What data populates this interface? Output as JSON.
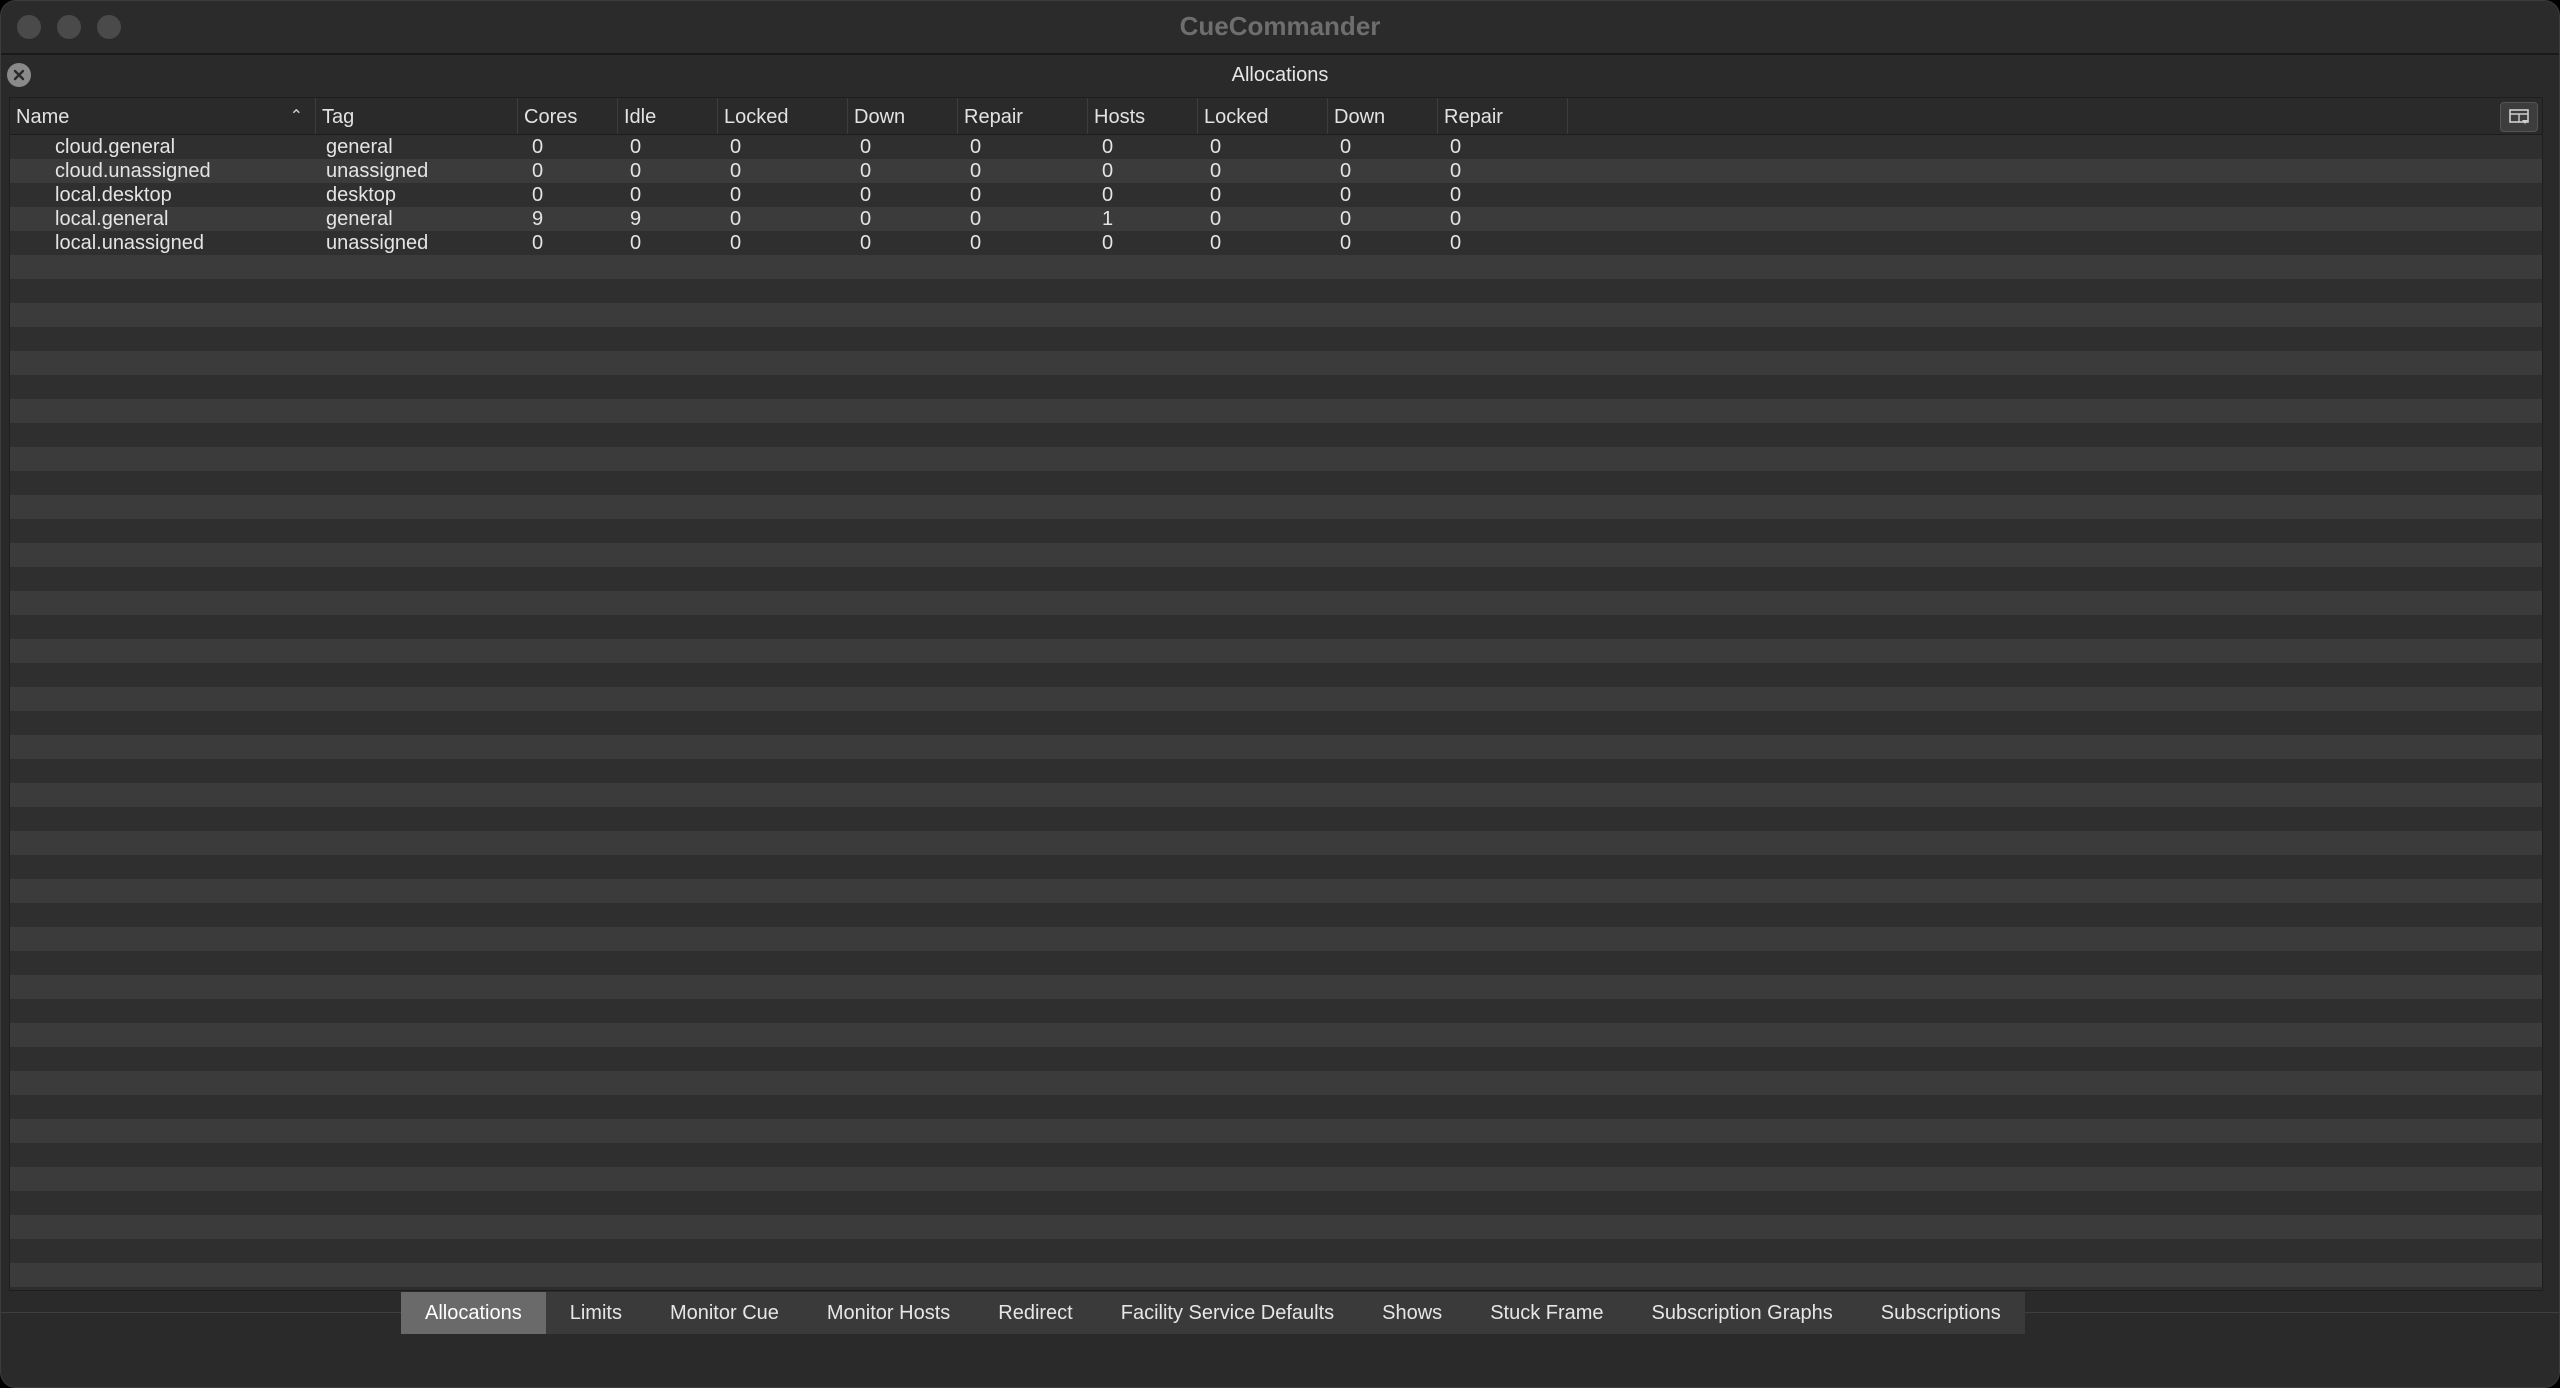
{
  "window": {
    "title": "CueCommander"
  },
  "dock": {
    "title": "Allocations"
  },
  "table": {
    "columns": [
      "Name",
      "Tag",
      "Cores",
      "Idle",
      "Locked",
      "Down",
      "Repair",
      "Hosts",
      "Locked",
      "Down",
      "Repair"
    ],
    "sort": {
      "column": "Name",
      "direction": "ascending"
    },
    "rows": [
      [
        "cloud.general",
        "general",
        "0",
        "0",
        "0",
        "0",
        "0",
        "0",
        "0",
        "0",
        "0"
      ],
      [
        "cloud.unassigned",
        "unassigned",
        "0",
        "0",
        "0",
        "0",
        "0",
        "0",
        "0",
        "0",
        "0"
      ],
      [
        "local.desktop",
        "desktop",
        "0",
        "0",
        "0",
        "0",
        "0",
        "0",
        "0",
        "0",
        "0"
      ],
      [
        "local.general",
        "general",
        "9",
        "9",
        "0",
        "0",
        "0",
        "1",
        "0",
        "0",
        "0"
      ],
      [
        "local.unassigned",
        "unassigned",
        "0",
        "0",
        "0",
        "0",
        "0",
        "0",
        "0",
        "0",
        "0"
      ]
    ]
  },
  "tabs": [
    {
      "label": "Allocations",
      "active": true
    },
    {
      "label": "Limits",
      "active": false
    },
    {
      "label": "Monitor Cue",
      "active": false
    },
    {
      "label": "Monitor Hosts",
      "active": false
    },
    {
      "label": "Redirect",
      "active": false
    },
    {
      "label": "Facility Service Defaults",
      "active": false
    },
    {
      "label": "Shows",
      "active": false
    },
    {
      "label": "Stuck Frame",
      "active": false
    },
    {
      "label": "Subscription Graphs",
      "active": false
    },
    {
      "label": "Subscriptions",
      "active": false
    }
  ]
}
